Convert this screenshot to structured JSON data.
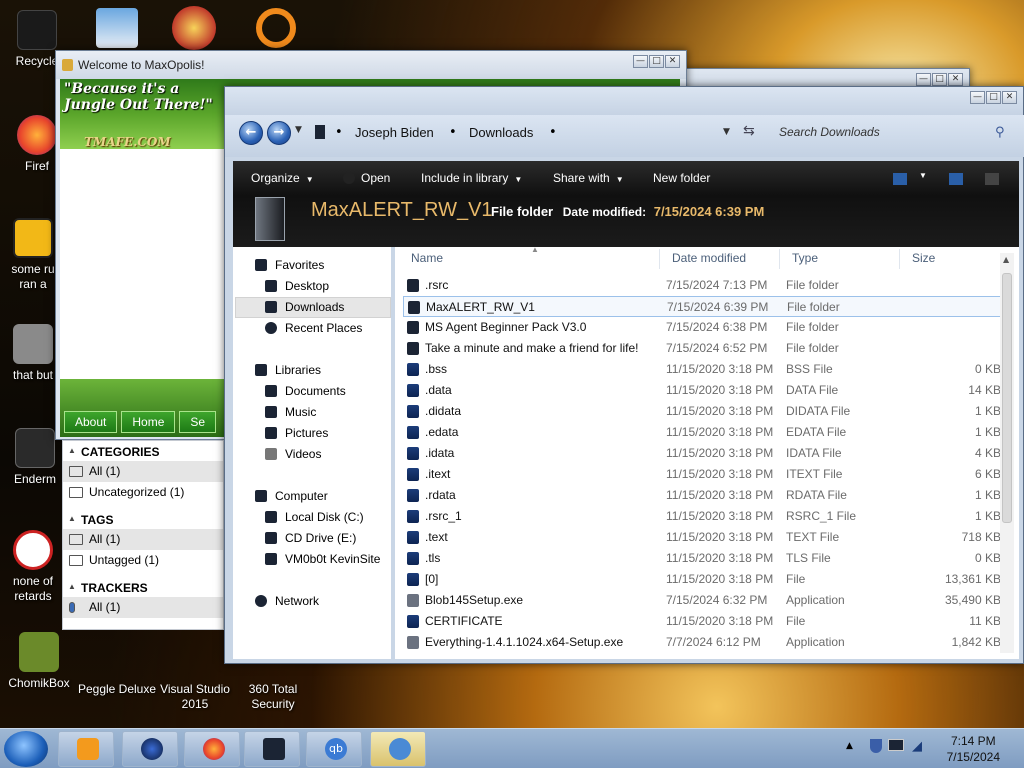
{
  "desktop": {
    "icons": [
      {
        "label": "Recycle",
        "color": "#222"
      },
      {
        "label": "Firef",
        "color": "#e8642c"
      },
      {
        "label": "some ru\nran a",
        "color": "#f2b817"
      },
      {
        "label": "that but",
        "color": "#777"
      },
      {
        "label": "Enderm",
        "color": "#333"
      },
      {
        "label": "none of\nretards",
        "color": "#c22"
      },
      {
        "label": "ChomikBox",
        "color": "#6b8a2a"
      },
      {
        "label": "Peggle Deluxe",
        "color": "#b53a2a"
      },
      {
        "label": "Visual Studio 2015",
        "color": "#6a3aa3"
      },
      {
        "label": "360 Total Security",
        "color": "#3a9a2a"
      }
    ]
  },
  "maxopolis": {
    "title": "Welcome to MaxOpolis!",
    "banner_line1": "\"Because it's a",
    "banner_line2": "Jungle Out There!\"",
    "logo": "TMAFE.COM",
    "nav": [
      "About",
      "Home",
      "Se"
    ]
  },
  "categories_panel": {
    "categories_header": "CATEGORIES",
    "categories": [
      "All (1)",
      "Uncategorized (1)"
    ],
    "tags_header": "TAGS",
    "tags": [
      "All (1)",
      "Untagged (1)"
    ],
    "trackers_header": "TRACKERS",
    "trackers": [
      "All (1)"
    ]
  },
  "explorer": {
    "breadcrumb": [
      "Joseph Biden",
      "Downloads"
    ],
    "search_placeholder": "Search Downloads",
    "toolbar": {
      "organize": "Organize",
      "open": "Open",
      "include": "Include in library",
      "share": "Share with",
      "new_folder": "New folder"
    },
    "details": {
      "name": "MaxALERT_RW_V1",
      "type": "File folder",
      "modified_label": "Date modified:",
      "modified_value": "7/15/2024 6:39 PM"
    },
    "nav": {
      "favorites": "Favorites",
      "desktop": "Desktop",
      "downloads": "Downloads",
      "recent": "Recent Places",
      "libraries": "Libraries",
      "documents": "Documents",
      "music": "Music",
      "pictures": "Pictures",
      "videos": "Videos",
      "computer": "Computer",
      "local_disk": "Local Disk (C:)",
      "cd_drive": "CD Drive (E:)",
      "vm": "VM0b0t KevinSite",
      "network": "Network"
    },
    "columns": {
      "name": "Name",
      "date": "Date modified",
      "type": "Type",
      "size": "Size"
    },
    "files": [
      {
        "name": ".rsrc",
        "date": "7/15/2024 7:13 PM",
        "type": "File folder",
        "size": "",
        "kind": "folder"
      },
      {
        "name": "MaxALERT_RW_V1",
        "date": "7/15/2024 6:39 PM",
        "type": "File folder",
        "size": "",
        "kind": "folder"
      },
      {
        "name": "MS Agent Beginner Pack V3.0",
        "date": "7/15/2024 6:38 PM",
        "type": "File folder",
        "size": "",
        "kind": "folder"
      },
      {
        "name": "Take a minute and make a friend for life!",
        "date": "7/15/2024 6:52 PM",
        "type": "File folder",
        "size": "",
        "kind": "folder"
      },
      {
        "name": ".bss",
        "date": "11/15/2020 3:18 PM",
        "type": "BSS File",
        "size": "0 KB",
        "kind": "file"
      },
      {
        "name": ".data",
        "date": "11/15/2020 3:18 PM",
        "type": "DATA File",
        "size": "14 KB",
        "kind": "file"
      },
      {
        "name": ".didata",
        "date": "11/15/2020 3:18 PM",
        "type": "DIDATA File",
        "size": "1 KB",
        "kind": "file"
      },
      {
        "name": ".edata",
        "date": "11/15/2020 3:18 PM",
        "type": "EDATA File",
        "size": "1 KB",
        "kind": "file"
      },
      {
        "name": ".idata",
        "date": "11/15/2020 3:18 PM",
        "type": "IDATA File",
        "size": "4 KB",
        "kind": "file"
      },
      {
        "name": ".itext",
        "date": "11/15/2020 3:18 PM",
        "type": "ITEXT File",
        "size": "6 KB",
        "kind": "file"
      },
      {
        "name": ".rdata",
        "date": "11/15/2020 3:18 PM",
        "type": "RDATA File",
        "size": "1 KB",
        "kind": "file"
      },
      {
        "name": ".rsrc_1",
        "date": "11/15/2020 3:18 PM",
        "type": "RSRC_1 File",
        "size": "1 KB",
        "kind": "file"
      },
      {
        "name": ".text",
        "date": "11/15/2020 3:18 PM",
        "type": "TEXT File",
        "size": "718 KB",
        "kind": "file"
      },
      {
        "name": ".tls",
        "date": "11/15/2020 3:18 PM",
        "type": "TLS File",
        "size": "0 KB",
        "kind": "file"
      },
      {
        "name": "[0]",
        "date": "11/15/2020 3:18 PM",
        "type": "File",
        "size": "13,361 KB",
        "kind": "file"
      },
      {
        "name": "Blob145Setup.exe",
        "date": "7/15/2024 6:32 PM",
        "type": "Application",
        "size": "35,490 KB",
        "kind": "app"
      },
      {
        "name": "CERTIFICATE",
        "date": "11/15/2020 3:18 PM",
        "type": "File",
        "size": "11 KB",
        "kind": "file"
      },
      {
        "name": "Everything-1.4.1.1024.x64-Setup.exe",
        "date": "7/7/2024 6:12 PM",
        "type": "Application",
        "size": "1,842 KB",
        "kind": "app"
      }
    ],
    "selected_index": 1
  },
  "taskbar": {
    "time": "7:14 PM",
    "date": "7/15/2024"
  }
}
